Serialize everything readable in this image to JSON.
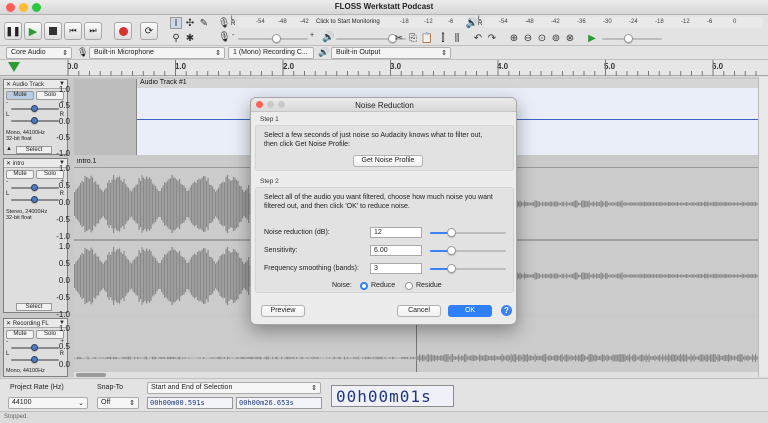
{
  "window": {
    "title": "FLOSS Werkstatt Podcast"
  },
  "meters": {
    "monitor_label": "Click to Start Monitoring",
    "record_ticks": [
      "-54",
      "-48",
      "-42",
      "-18",
      "-12",
      "-6",
      "0"
    ],
    "play_ticks": [
      "-54",
      "-48",
      "-42",
      "-36",
      "-30",
      "-24",
      "-18",
      "-12",
      "-6",
      "0"
    ],
    "record_side_labels": [
      "L",
      "R"
    ],
    "play_side_labels": [
      "L",
      "R"
    ]
  },
  "devices": {
    "host": "Core Audio",
    "input": "Built-in Microphone",
    "channels": "1 (Mono) Recording C...",
    "output": "Built-in Output"
  },
  "ruler": {
    "ticks": [
      "0.0",
      "1.0",
      "2.0",
      "3.0",
      "4.0",
      "5.0",
      "6.0"
    ]
  },
  "tracks": [
    {
      "name": "Audio Track",
      "mute": "Mute",
      "solo": "Solo",
      "info": [
        "Mono, 44100Hz",
        "32-bit float"
      ],
      "select": "Select",
      "clip": "Audio Track #1",
      "scale": [
        "1.0",
        "0.5",
        "0.0",
        "-0.5",
        "-1.0"
      ]
    },
    {
      "name": "intro",
      "mute": "Mute",
      "solo": "Solo",
      "info": [
        "Stereo, 24000Hz",
        "32-bit float"
      ],
      "select": "Select",
      "clip": "intro.1",
      "scale": [
        "1.0",
        "0.5",
        "0.0",
        "-0.5",
        "-1.0",
        "1.0",
        "0.5",
        "0.0",
        "-0.5",
        "-1.0"
      ]
    },
    {
      "name": "Recording FL",
      "mute": "Mute",
      "solo": "Solo",
      "info": [
        "Mono, 44100Hz"
      ],
      "scale": [
        "1.0",
        "0.5",
        "0.0"
      ]
    }
  ],
  "gain_pan": {
    "minus": "-",
    "plus": "+",
    "left": "L",
    "right": "R"
  },
  "dialog": {
    "title": "Noise Reduction",
    "step1_label": "Step 1",
    "step1_text": [
      "Select a few seconds of just noise so Audacity knows what to filter out,",
      "then click Get Noise Profile:"
    ],
    "get_profile": "Get Noise Profile",
    "step2_label": "Step 2",
    "step2_text": [
      "Select all of the audio you want filtered, choose how much noise you want",
      "filtered out, and then click 'OK' to reduce noise."
    ],
    "fields": [
      {
        "label": "Noise reduction (dB):",
        "value": "12",
        "level": 0.28
      },
      {
        "label": "Sensitivity:",
        "value": "6.00",
        "level": 0.28
      },
      {
        "label": "Frequency smoothing (bands):",
        "value": "3",
        "level": 0.28
      }
    ],
    "noise_label": "Noise:",
    "reduce": "Reduce",
    "residue": "Residue",
    "preview": "Preview",
    "cancel": "Cancel",
    "ok": "OK",
    "help": "?"
  },
  "bottom": {
    "rate_label": "Project Rate (Hz)",
    "rate_value": "44100",
    "snap_label": "Snap-To",
    "snap_value": "Off",
    "selection_mode": "Start and End of Selection",
    "sel_start": "00h00m00.591s",
    "sel_end": "00h00m26.653s",
    "big_time": "00h00m01s"
  },
  "status": "Stopped.",
  "colors": {
    "accent": "#2f7ff7",
    "waveform": "#3b62c4",
    "waveform_dim": "#7a7a7a",
    "record": "#d8322f",
    "play": "#2e9b34"
  }
}
